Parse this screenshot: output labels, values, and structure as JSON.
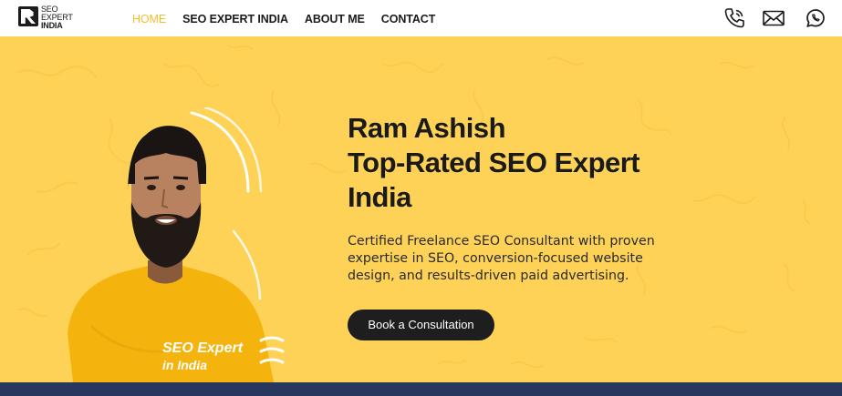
{
  "brand": {
    "logo_line1": "SEO",
    "logo_line2": "EXPERT",
    "logo_line3": "INDIA"
  },
  "nav": {
    "items": [
      {
        "label": "HOME",
        "active": true
      },
      {
        "label": "SEO EXPERT INDIA",
        "active": false
      },
      {
        "label": "ABOUT ME",
        "active": false
      },
      {
        "label": "CONTACT",
        "active": false
      }
    ],
    "icons": [
      "phone-icon",
      "mail-icon",
      "whatsapp-icon"
    ]
  },
  "hero": {
    "title_line1": "Ram Ashish",
    "title_line2": "Top-Rated SEO Expert",
    "title_line3": "India",
    "description": "Certified Freelance SEO Consultant with proven expertise in SEO, conversion-focused website design, and results-driven paid advertising.",
    "cta_label": "Book a Consultation",
    "shirt_text_line1": "SEO Expert",
    "shirt_text_line2": "in India"
  },
  "colors": {
    "hero_bg": "#fdd257",
    "accent": "#f2bd2c",
    "dark": "#1e1e1e",
    "footer": "#27375e"
  }
}
